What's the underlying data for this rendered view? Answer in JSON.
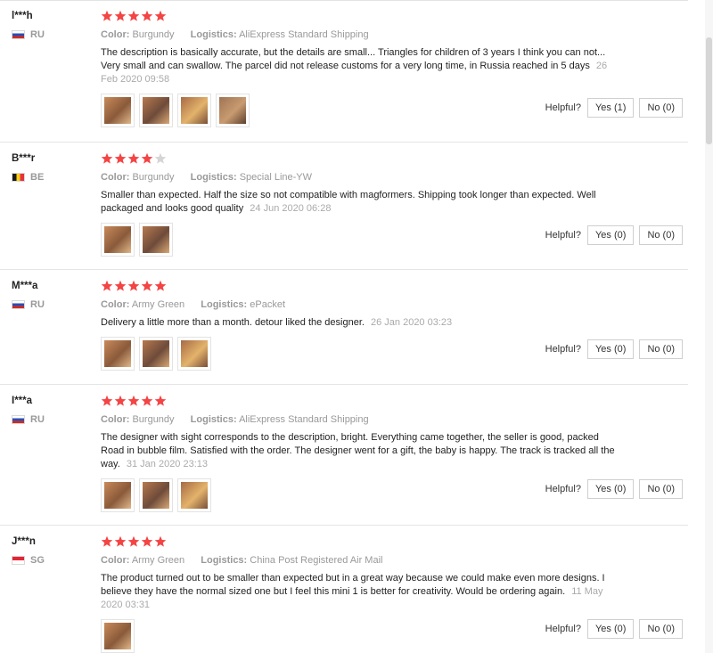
{
  "labels": {
    "color": "Color:",
    "logistics": "Logistics:",
    "helpful": "Helpful?"
  },
  "colors": {
    "star_on": "#f44444",
    "star_off": "#d5d5d5",
    "muted": "#999999"
  },
  "reviews": [
    {
      "user": "l***h",
      "country": "RU",
      "flag": "russia-flag-icon",
      "stars": 5,
      "color": "Burgundy",
      "logistics": "AliExpress Standard Shipping",
      "text": "The description is basically accurate, but the details are small... Triangles for children of 3 years I think you can not... Very small and can swallow. The parcel did not release customs for a very long time, in Russia reached in 5 days",
      "date": "26 Feb 2020 09:58",
      "photos": 4,
      "yes": "Yes (1)",
      "no": "No (0)"
    },
    {
      "user": "B***r",
      "country": "BE",
      "flag": "belgium-flag-icon",
      "stars": 4,
      "color": "Burgundy",
      "logistics": "Special Line-YW",
      "text": "Smaller than expected. Half the size so not compatible with magformers. Shipping took longer than expected. Well packaged and looks good quality",
      "date": "24 Jun 2020 06:28",
      "photos": 2,
      "yes": "Yes (0)",
      "no": "No (0)"
    },
    {
      "user": "M***a",
      "country": "RU",
      "flag": "russia-flag-icon",
      "stars": 5,
      "color": "Army Green",
      "logistics": "ePacket",
      "text": "Delivery a little more than a month. detour liked the designer.",
      "date": "26 Jan 2020 03:23",
      "photos": 3,
      "yes": "Yes (0)",
      "no": "No (0)"
    },
    {
      "user": "I***a",
      "country": "RU",
      "flag": "russia-flag-icon",
      "stars": 5,
      "color": "Burgundy",
      "logistics": "AliExpress Standard Shipping",
      "text": "The designer with sight corresponds to the description, bright. Everything came together, the seller is good, packed Road in bubble film. Satisfied with the order. The designer went for a gift, the baby is happy. The track is tracked all the way.",
      "date": "31 Jan 2020 23:13",
      "photos": 3,
      "yes": "Yes (0)",
      "no": "No (0)"
    },
    {
      "user": "J***n",
      "country": "SG",
      "flag": "singapore-flag-icon",
      "stars": 5,
      "color": "Army Green",
      "logistics": "China Post Registered Air Mail",
      "text": "The product turned out to be smaller than expected but in a great way because we could make even more designs. I believe they have the normal sized one but I feel this mini 1 is better for creativity. Would be ordering again.",
      "date": "11 May 2020 03:31",
      "photos": 1,
      "yes": "Yes (0)",
      "no": "No (0)"
    }
  ]
}
